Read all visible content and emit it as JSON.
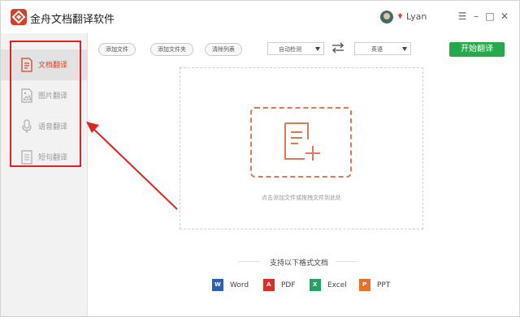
{
  "app": {
    "title": "金舟文档翻译软件"
  },
  "user": {
    "name": "Lyan"
  },
  "window_controls": {
    "menu": "☰",
    "minimize": "–",
    "maximize": "□",
    "close": "✕"
  },
  "sidebar": {
    "items": [
      {
        "label": "文档翻译",
        "icon": "document-icon",
        "active": true
      },
      {
        "label": "图片翻译",
        "icon": "image-icon",
        "active": false
      },
      {
        "label": "语音翻译",
        "icon": "microphone-icon",
        "active": false
      },
      {
        "label": "短句翻译",
        "icon": "text-lines-icon",
        "active": false
      }
    ]
  },
  "toolbar": {
    "add_file": "添加文件",
    "add_folder": "添加文件夹",
    "clear_list": "清除列表",
    "source_lang": "自动检测",
    "target_lang": "英语",
    "start": "开始翻译"
  },
  "dropzone": {
    "hint": "点击添加文件或拖拽文件到此处"
  },
  "formats": {
    "title": "支持以下格式文档",
    "items": [
      {
        "label": "Word",
        "icon": "word-icon",
        "color": "#2b5fb4",
        "letter": "W"
      },
      {
        "label": "PDF",
        "icon": "pdf-icon",
        "color": "#d9302b",
        "letter": "A"
      },
      {
        "label": "Excel",
        "icon": "excel-icon",
        "color": "#21a366",
        "letter": "X"
      },
      {
        "label": "PPT",
        "icon": "ppt-icon",
        "color": "#e8702a",
        "letter": "P"
      }
    ]
  },
  "colors": {
    "accent": "#d9402b",
    "start_button": "#27a84a",
    "annotation": "#e02424"
  }
}
